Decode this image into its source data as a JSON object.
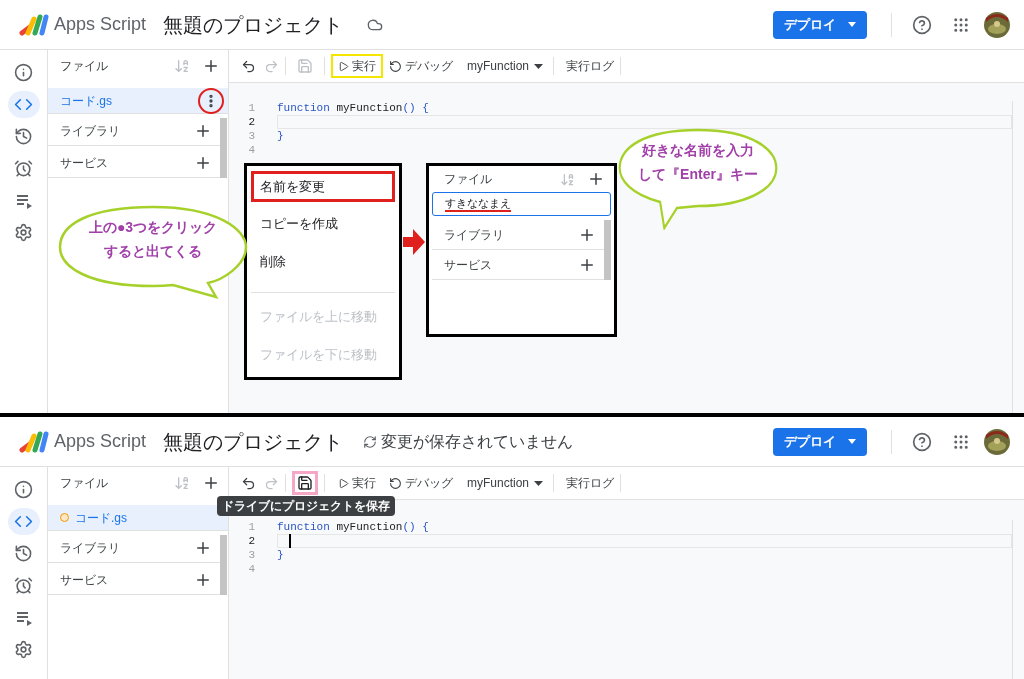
{
  "panels": [
    {
      "header": {
        "product": "Apps Script",
        "project_title": "無題のプロジェクト",
        "saved": true,
        "deploy_label": "デプロイ"
      },
      "rail": [
        {
          "kind": "info",
          "selected": false
        },
        {
          "kind": "code",
          "selected": true
        },
        {
          "kind": "history",
          "selected": false
        },
        {
          "kind": "triggers",
          "selected": false
        },
        {
          "kind": "executions",
          "selected": false
        },
        {
          "kind": "settings",
          "selected": false
        }
      ],
      "sidebar": {
        "title": "ファイル",
        "files": [
          {
            "name": "コード.gs",
            "selected": true,
            "unsaved": false,
            "menu_circled": true
          }
        ],
        "sections": [
          "ライブラリ",
          "サービス"
        ]
      },
      "toolbar": {
        "save_enabled": false,
        "save_highlighted": false,
        "run_label": "実行",
        "run_highlighted": true,
        "debug_label": "デバッグ",
        "function_name": "myFunction",
        "log_label": "実行ログ"
      },
      "editor": {
        "cursor": false,
        "lines": [
          {
            "number": "1",
            "tokens": [
              {
                "kind": "keyword",
                "text": "function"
              },
              {
                "kind": "name",
                "text": " myFunction"
              },
              {
                "kind": "punct",
                "text": "() {"
              }
            ]
          },
          {
            "number": "2",
            "active": true
          },
          {
            "number": "3",
            "tokens": [
              {
                "kind": "punct",
                "text": "}"
              }
            ]
          },
          {
            "number": "4"
          }
        ]
      },
      "annotations": {
        "context_menu": [
          {
            "label": "名前を変更",
            "disabled": false,
            "highlighted": true
          },
          {
            "label": "コピーを作成",
            "disabled": false,
            "highlighted": false
          },
          {
            "label": "削除",
            "disabled": false,
            "highlighted": false
          },
          {
            "label": "ファイルを上に移動",
            "disabled": true,
            "highlighted": false
          },
          {
            "label": "ファイルを下に移動",
            "disabled": true,
            "highlighted": false
          }
        ],
        "rename_preview": {
          "title": "ファイル",
          "input_value": "すきななまえ",
          "sections": [
            "ライブラリ",
            "サービス"
          ]
        },
        "callouts": [
          {
            "lines": [
              "上の●3つをクリック",
              "すると出てくる"
            ]
          },
          {
            "lines": [
              "好きな名前を入力",
              "して『Enter』キー"
            ]
          }
        ]
      }
    },
    {
      "header": {
        "product": "Apps Script",
        "project_title": "無題のプロジェクト",
        "saved": false,
        "status": "変更が保存されていません",
        "deploy_label": "デプロイ"
      },
      "rail": [
        {
          "kind": "info",
          "selected": false
        },
        {
          "kind": "code",
          "selected": true
        },
        {
          "kind": "history",
          "selected": false
        },
        {
          "kind": "triggers",
          "selected": false
        },
        {
          "kind": "executions",
          "selected": false
        },
        {
          "kind": "settings",
          "selected": false
        }
      ],
      "sidebar": {
        "title": "ファイル",
        "files": [
          {
            "name": "コード.gs",
            "selected": true,
            "unsaved": true,
            "menu_circled": false
          }
        ],
        "sections": [
          "ライブラリ",
          "サービス"
        ]
      },
      "toolbar": {
        "save_enabled": true,
        "save_highlighted": true,
        "tooltip": "ドライブにプロジェクトを保存",
        "run_label": "実行",
        "run_highlighted": false,
        "debug_label": "デバッグ",
        "function_name": "myFunction",
        "log_label": "実行ログ"
      },
      "editor": {
        "cursor": true,
        "lines": [
          {
            "number": "1",
            "tokens": [
              {
                "kind": "keyword",
                "text": "function"
              },
              {
                "kind": "name",
                "text": " myFunction"
              },
              {
                "kind": "punct",
                "text": "() {"
              }
            ]
          },
          {
            "number": "2",
            "active": true
          },
          {
            "number": "3",
            "tokens": [
              {
                "kind": "punct",
                "text": "}"
              }
            ]
          },
          {
            "number": "4"
          }
        ]
      }
    }
  ]
}
